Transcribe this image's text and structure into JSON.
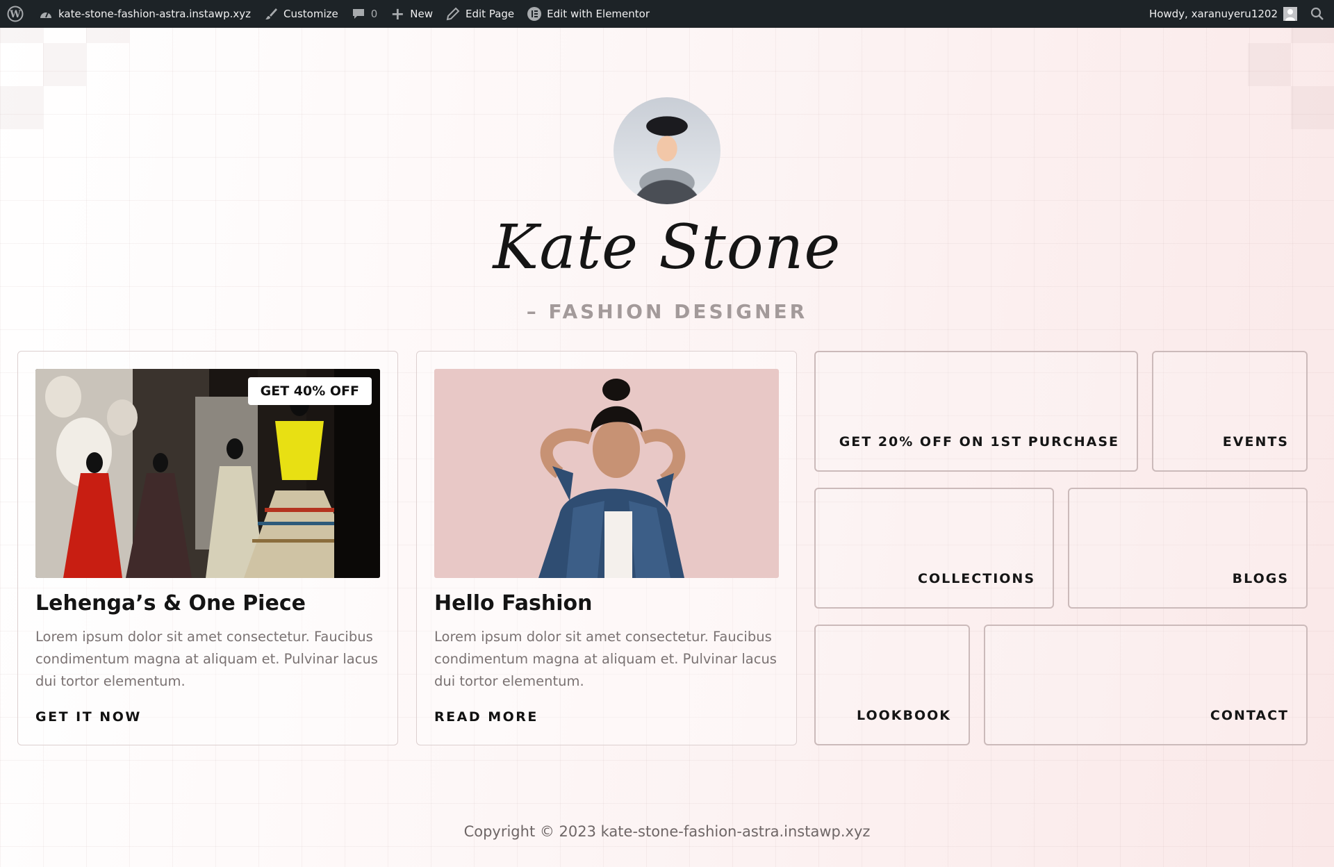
{
  "adminbar": {
    "site_name": "kate-stone-fashion-astra.instawp.xyz",
    "customize": "Customize",
    "comments_count": "0",
    "new": "New",
    "edit_page": "Edit Page",
    "edit_elementor": "Edit with Elementor",
    "howdy": "Howdy, xaranuyeru1202"
  },
  "hero": {
    "name": "Kate Stone",
    "subtitle": "– FASHION DESIGNER"
  },
  "cards": [
    {
      "title": "Lehenga’s & One Piece",
      "badge": "GET 40% OFF",
      "text": "Lorem ipsum dolor sit amet consectetur. Faucibus condimentum magna at aliquam et. Pulvinar lacus dui tortor elementum.",
      "link": "GET IT NOW"
    },
    {
      "title": "Hello Fashion",
      "text": "Lorem ipsum dolor sit amet consectetur. Faucibus condimentum magna at aliquam et. Pulvinar lacus dui tortor elementum.",
      "link": "READ MORE"
    }
  ],
  "tiles": {
    "offer": "GET 20% OFF ON 1ST PURCHASE",
    "events": "EVENTS",
    "collections": "COLLECTIONS",
    "blogs": "BLOGS",
    "lookbook": "LOOKBOOK",
    "contact": "CONTACT"
  },
  "footer": {
    "copyright": "Copyright © 2023 kate-stone-fashion-astra.instawp.xyz"
  }
}
